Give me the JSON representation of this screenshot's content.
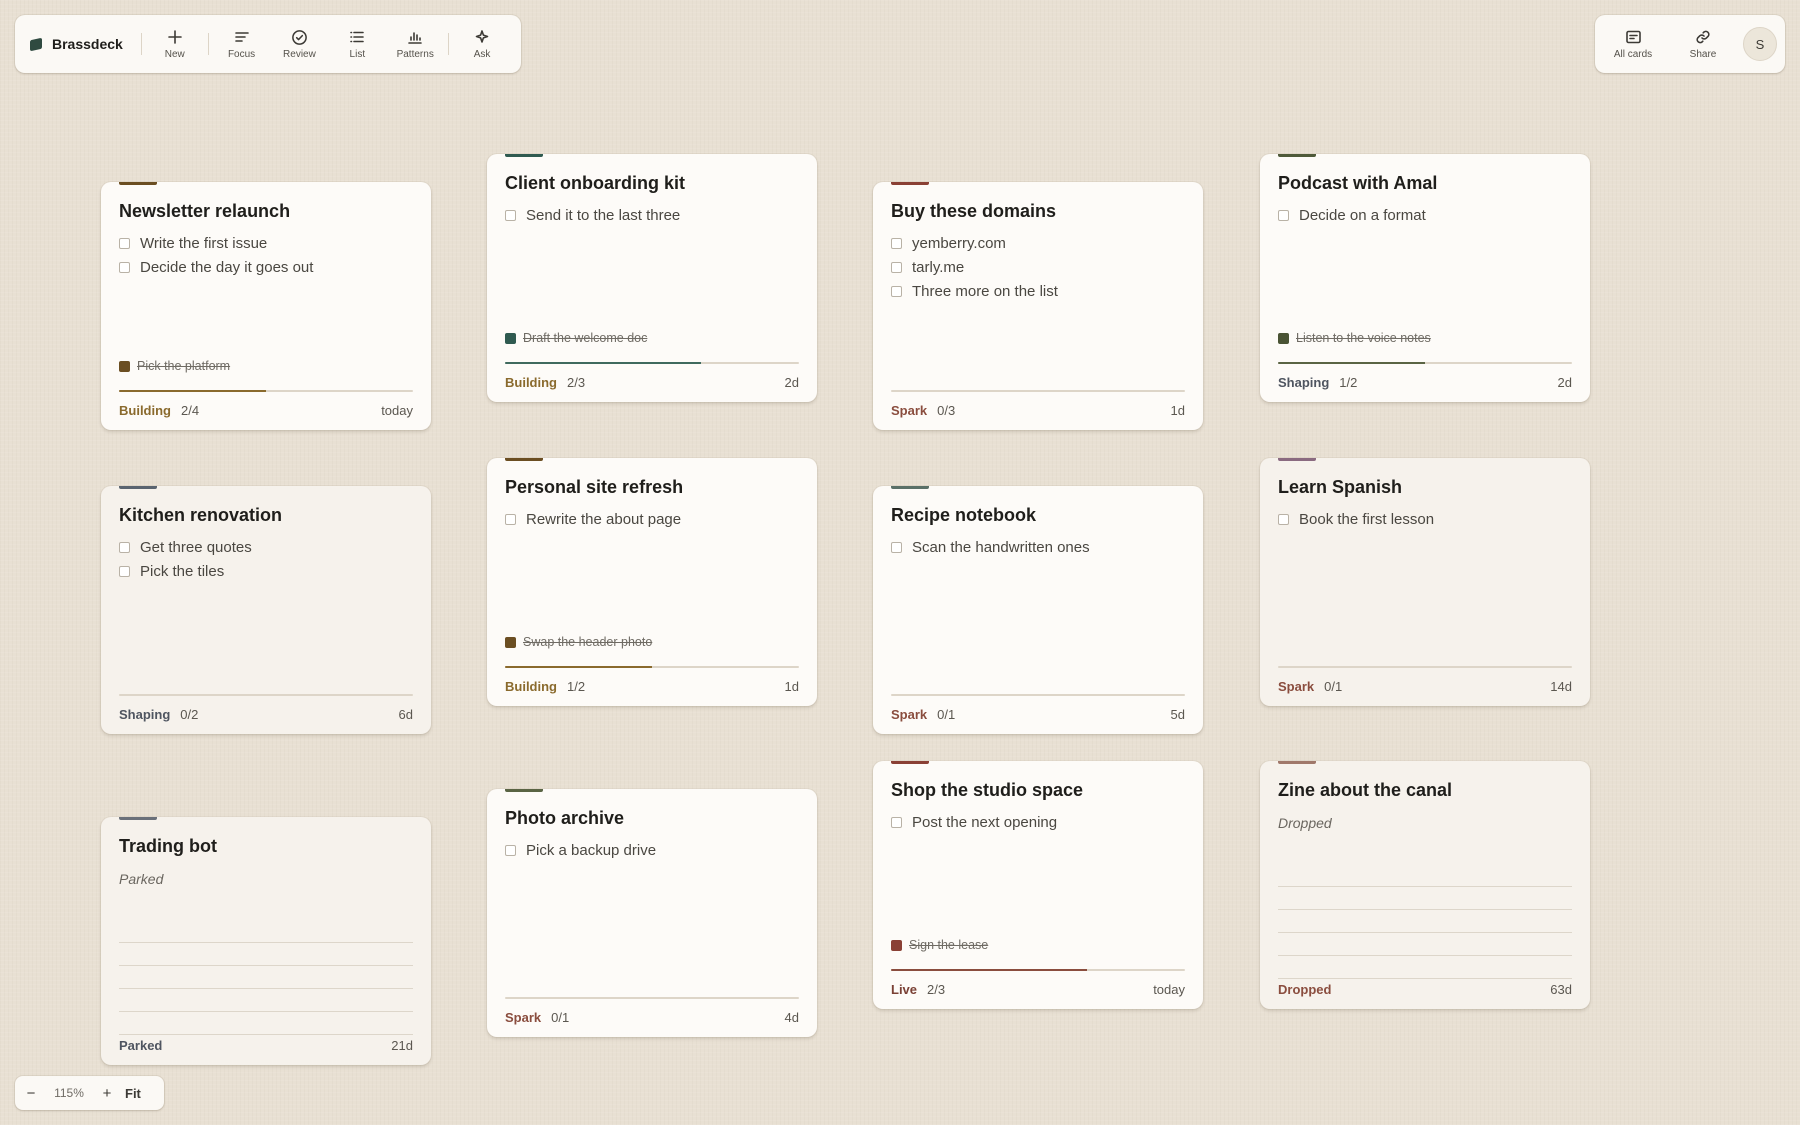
{
  "app": {
    "name": "Brassdeck"
  },
  "toolbar": {
    "new": "New",
    "focus": "Focus",
    "review": "Review",
    "list": "List",
    "patterns": "Patterns",
    "ask": "Ask",
    "all_cards": "All cards",
    "share": "Share",
    "avatar": "S"
  },
  "colors": {
    "building": "#8a6a2d",
    "shaping": "#4f5560",
    "spark": "#8a4d3e",
    "live": "#7a4035",
    "dropped": "#8a4d3e",
    "parked": "#4f5560"
  },
  "cards": [
    {
      "title": "Newsletter relaunch",
      "accent": "#6b4e22",
      "tasks": [
        "Write the first issue",
        "Decide the day it goes out"
      ],
      "done": "Pick the platform",
      "done_color": "#6b4e22",
      "progress": 0.5,
      "bar_color": "#8a6a2d",
      "status": "Building",
      "count": "2/4",
      "age": "today"
    },
    {
      "title": "Client onboarding kit",
      "accent": "#2f5a50",
      "tasks": [
        "Send it to the last three"
      ],
      "done": "Draft the welcome doc",
      "done_color": "#2f5a50",
      "progress": 0.6667,
      "bar_color": "#3f6a5e",
      "status": "Building",
      "count": "2/3",
      "age": "2d"
    },
    {
      "title": "Buy these domains",
      "accent": "#8a4035",
      "tasks": [
        "yemberry.com",
        "tarly.me",
        "Three more on the list"
      ],
      "done": "",
      "progress": 0,
      "bar_color": "#8a4d3e",
      "status": "Spark",
      "count": "0/3",
      "age": "1d"
    },
    {
      "title": "Podcast with Amal",
      "accent": "#4f5a3a",
      "tasks": [
        "Decide on a format"
      ],
      "done": "Listen to the voice notes",
      "done_color": "#4a5334",
      "progress": 0.5,
      "bar_color": "#5a6444",
      "status": "Shaping",
      "count": "1/2",
      "age": "2d"
    },
    {
      "title": "Kitchen renovation",
      "accent": "#5a6470",
      "tasks": [
        "Get three quotes",
        "Pick the tiles"
      ],
      "done": "",
      "progress": 0,
      "bar_color": "#4f5560",
      "status": "Shaping",
      "count": "0/2",
      "age": "6d"
    },
    {
      "title": "Personal site refresh",
      "accent": "#6b4e22",
      "tasks": [
        "Rewrite the about page"
      ],
      "done": "Swap the header photo",
      "done_color": "#6b4e22",
      "progress": 0.5,
      "bar_color": "#8a6a2d",
      "status": "Building",
      "count": "1/2",
      "age": "1d"
    },
    {
      "title": "Recipe notebook",
      "accent": "#5a7068",
      "tasks": [
        "Scan the handwritten ones"
      ],
      "done": "",
      "progress": 0,
      "bar_color": "#4f6058",
      "status": "Spark",
      "count": "0/1",
      "age": "5d"
    },
    {
      "title": "Learn Spanish",
      "accent": "#8a6a80",
      "tasks": [
        "Book the first lesson"
      ],
      "done": "",
      "progress": 0,
      "bar_color": "#8a4d3e",
      "status": "Spark",
      "count": "0/1",
      "age": "14d"
    },
    {
      "title": "Trading bot",
      "accent": "#6a707a",
      "note": "Parked",
      "status": "Parked",
      "age": "21d"
    },
    {
      "title": "Photo archive",
      "accent": "#5a6444",
      "tasks": [
        "Pick a backup drive"
      ],
      "done": "",
      "progress": 0,
      "bar_color": "#5a6444",
      "status": "Spark",
      "count": "0/1",
      "age": "4d"
    },
    {
      "title": "Shop the studio space",
      "accent": "#8a4035",
      "tasks": [
        "Post the next opening"
      ],
      "done": "Sign the lease",
      "done_color": "#8a4035",
      "progress": 0.6667,
      "bar_color": "#8a4d3e",
      "status": "Live",
      "count": "2/3",
      "age": "today"
    },
    {
      "title": "Zine about the canal",
      "accent": "#a0786a",
      "note": "Dropped",
      "status": "Dropped",
      "age": "63d"
    }
  ],
  "zoom": {
    "minus": "−",
    "level": "115%",
    "plus": "+",
    "fit": "Fit"
  }
}
